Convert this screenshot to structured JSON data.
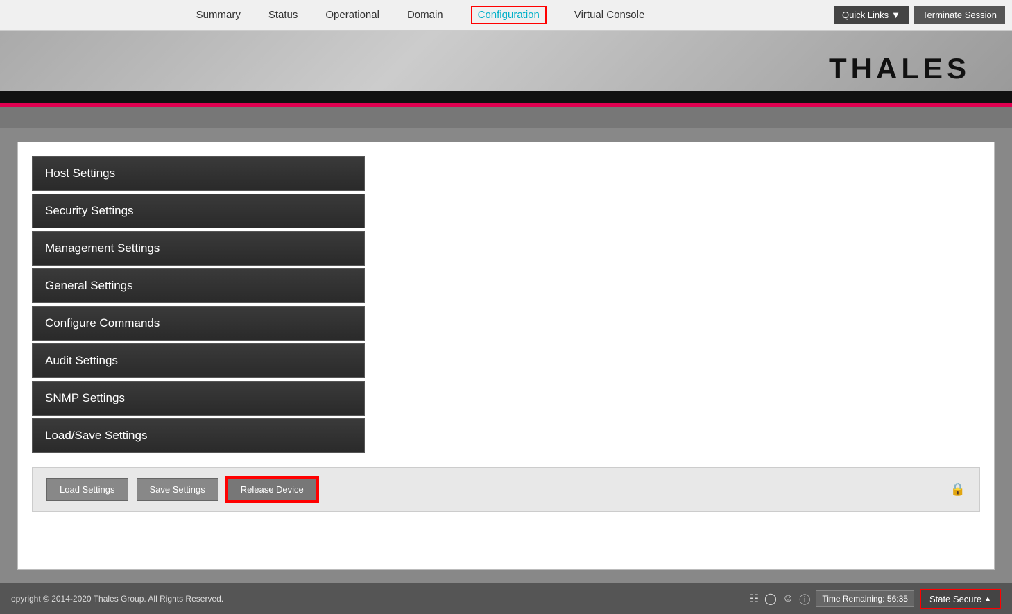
{
  "nav": {
    "links": [
      {
        "id": "summary",
        "label": "Summary",
        "active": false
      },
      {
        "id": "status",
        "label": "Status",
        "active": false
      },
      {
        "id": "operational",
        "label": "Operational",
        "active": false
      },
      {
        "id": "domain",
        "label": "Domain",
        "active": false
      },
      {
        "id": "configuration",
        "label": "Configuration",
        "active": true
      },
      {
        "id": "virtual-console",
        "label": "Virtual Console",
        "active": false
      }
    ],
    "quick_links_label": "Quick Links",
    "terminate_session_label": "Terminate Session"
  },
  "header": {
    "brand": "THALES"
  },
  "sidebar": {
    "items": [
      {
        "id": "host-settings",
        "label": "Host Settings"
      },
      {
        "id": "security-settings",
        "label": "Security Settings"
      },
      {
        "id": "management-settings",
        "label": "Management Settings"
      },
      {
        "id": "general-settings",
        "label": "General Settings"
      },
      {
        "id": "configure-commands",
        "label": "Configure Commands"
      },
      {
        "id": "audit-settings",
        "label": "Audit Settings"
      },
      {
        "id": "snmp-settings",
        "label": "SNMP Settings"
      },
      {
        "id": "load-save-settings",
        "label": "Load/Save Settings"
      }
    ]
  },
  "action_bar": {
    "load_settings_label": "Load Settings",
    "save_settings_label": "Save Settings",
    "release_device_label": "Release Device"
  },
  "footer": {
    "copyright": "opyright © 2014-2020 Thales Group. All Rights Reserved.",
    "time_remaining_label": "Time Remaining: 56:35",
    "state_secure_label": "State Secure"
  }
}
